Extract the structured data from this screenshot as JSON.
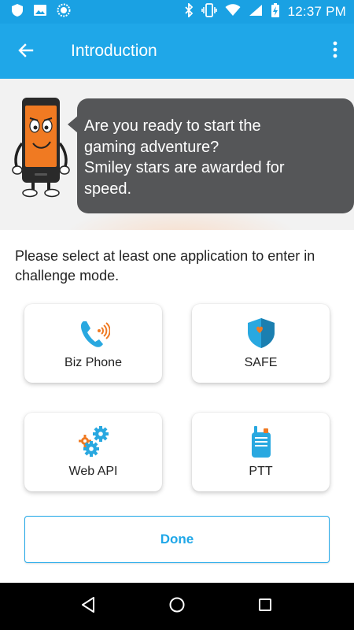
{
  "status_bar": {
    "time": "12:37 PM",
    "left_icons": [
      "shield-icon",
      "image-icon",
      "circle-dots-icon"
    ],
    "right_icons": [
      "bluetooth-icon",
      "vibrate-icon",
      "wifi-icon",
      "signal-icon",
      "battery-charging-icon"
    ]
  },
  "app_bar": {
    "title": "Introduction",
    "back_icon": "arrow-left-icon",
    "menu_icon": "more-vertical-icon"
  },
  "intro": {
    "bubble_lines": [
      "Are you ready to start the",
      "gaming adventure?",
      "Smiley stars are awarded for",
      "speed."
    ]
  },
  "instructions": "Please select at least one application to enter in challenge mode.",
  "apps": [
    {
      "label": "Biz Phone",
      "icon": "phone-wave-icon"
    },
    {
      "label": "SAFE",
      "icon": "shield-heart-icon"
    },
    {
      "label": "Web API",
      "icon": "gears-icon"
    },
    {
      "label": "PTT",
      "icon": "walkie-talkie-icon"
    }
  ],
  "done_label": "Done",
  "colors": {
    "status_bar": "#1aa1e3",
    "app_bar": "#1fa7e8",
    "accent": "#1fa7e8",
    "bubble": "#555658",
    "orange": "#f07a22",
    "icon_blue": "#29a8e0"
  },
  "nav_bar": {
    "icons": [
      "back-triangle-icon",
      "home-circle-icon",
      "recents-square-icon"
    ]
  }
}
